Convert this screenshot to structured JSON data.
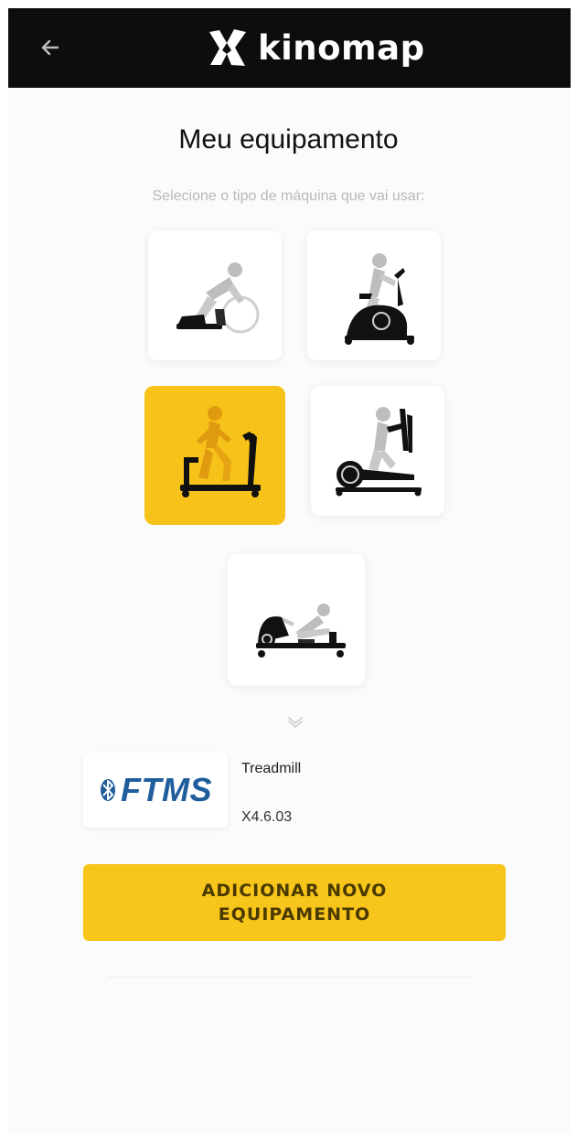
{
  "header": {
    "brand": "kinomap",
    "background": "#0d0d0d",
    "back_icon": "arrow-left-icon",
    "logo_icon": "kinomap-mark-icon"
  },
  "page": {
    "title": "Meu equipamento",
    "subtitle": "Selecione o tipo de máquina que vai usar:"
  },
  "machines": [
    {
      "id": "bike-trainer",
      "icon": "bike-trainer-icon",
      "selected": false
    },
    {
      "id": "exercise-bike",
      "icon": "exercise-bike-icon",
      "selected": false
    },
    {
      "id": "treadmill",
      "icon": "treadmill-icon",
      "selected": true
    },
    {
      "id": "elliptical",
      "icon": "elliptical-icon",
      "selected": false
    },
    {
      "id": "rower",
      "icon": "rower-icon",
      "selected": false
    }
  ],
  "device": {
    "logo_text": "FTMS",
    "type": "Treadmill",
    "id": "X4.6.03"
  },
  "actions": {
    "add_button": "ADICIONAR NOVO EQUIPAMENTO",
    "expand_icon": "chevron-down-icon"
  },
  "colors": {
    "accent": "#f7c31a",
    "ftms_blue": "#1f5d9c",
    "subtitle_gray": "#b9b9b9"
  }
}
